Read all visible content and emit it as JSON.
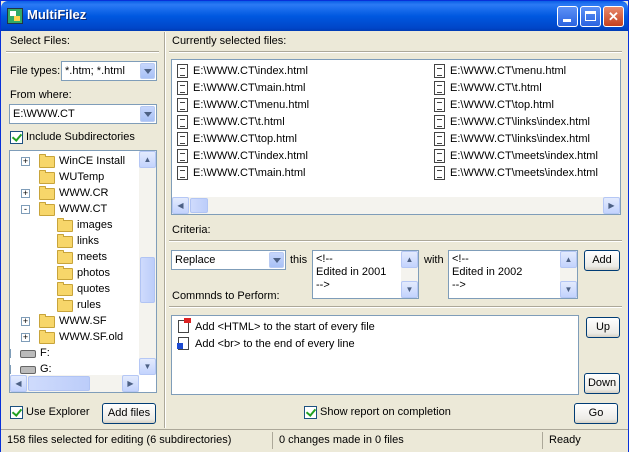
{
  "window": {
    "title": "MultiFilez"
  },
  "left": {
    "select_files_label": "Select Files:",
    "file_types_label": "File types:",
    "file_types_value": "*.htm; *.html",
    "from_where_label": "From where:",
    "from_where_value": "E:\\WWW.CT",
    "include_subdirs_label": "Include Subdirectories",
    "tree": [
      {
        "label": "WinCE Install",
        "expander": "+"
      },
      {
        "label": "WUTemp",
        "expander": ""
      },
      {
        "label": "WWW.CR",
        "expander": "+"
      },
      {
        "label": "WWW.CT",
        "expander": "-"
      },
      {
        "label": "images",
        "expander": ""
      },
      {
        "label": "links",
        "expander": ""
      },
      {
        "label": "meets",
        "expander": ""
      },
      {
        "label": "photos",
        "expander": ""
      },
      {
        "label": "quotes",
        "expander": ""
      },
      {
        "label": "rules",
        "expander": ""
      },
      {
        "label": "WWW.SF",
        "expander": "+"
      },
      {
        "label": "WWW.SF.old",
        "expander": "+"
      },
      {
        "label": "F:",
        "expander": "+"
      },
      {
        "label": "G:",
        "expander": "+"
      }
    ],
    "use_explorer_label": "Use Explorer",
    "add_files_label": "Add files"
  },
  "files": {
    "label": "Currently selected files:",
    "col1": [
      "E:\\WWW.CT\\index.html",
      "E:\\WWW.CT\\main.html",
      "E:\\WWW.CT\\menu.html",
      "E:\\WWW.CT\\t.html",
      "E:\\WWW.CT\\top.html",
      "E:\\WWW.CT\\index.html",
      "E:\\WWW.CT\\main.html"
    ],
    "col2": [
      "E:\\WWW.CT\\menu.html",
      "E:\\WWW.CT\\t.html",
      "E:\\WWW.CT\\top.html",
      "E:\\WWW.CT\\links\\index.html",
      "E:\\WWW.CT\\links\\index.html",
      "E:\\WWW.CT\\meets\\index.html",
      "E:\\WWW.CT\\meets\\index.html"
    ]
  },
  "criteria": {
    "label": "Criteria:",
    "action_value": "Replace",
    "this_label": "this",
    "this_text": "<!--\nEdited in 2001\n-->",
    "with_label": "with",
    "with_text": "<!--\nEdited in 2002\n-->",
    "add_label": "Add"
  },
  "commands": {
    "label": "Commnds to Perform:",
    "items": [
      "Add <HTML> to the start of every file",
      "Add <br> to the end of every line"
    ],
    "up_label": "Up",
    "down_label": "Down"
  },
  "footer": {
    "show_report_label": "Show report on completion",
    "go_label": "Go"
  },
  "status": {
    "selected": "158 files selected for editing (6 subdirectories)",
    "changes": "0 changes made in 0 files",
    "state": "Ready"
  },
  "colors": {
    "title_bar": "#0058e0",
    "accent_border": "#003c74"
  }
}
